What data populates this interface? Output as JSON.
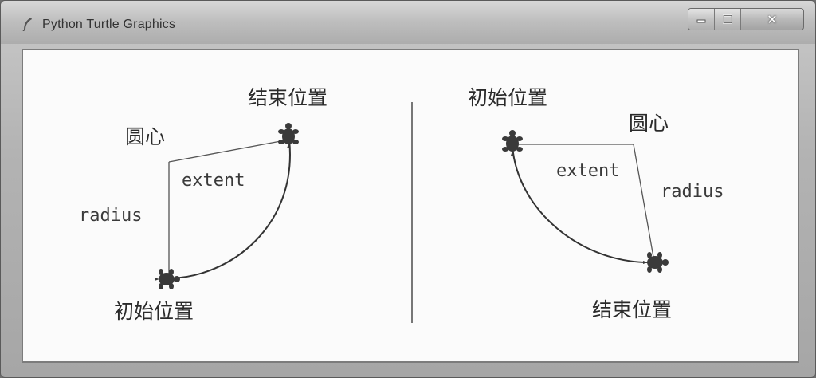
{
  "window": {
    "title": "Python Turtle Graphics",
    "close_glyph": "✕"
  },
  "left_diagram": {
    "end_label": "结束位置",
    "center_label": "圆心",
    "extent_label": "extent",
    "radius_label": "radius",
    "start_label": "初始位置"
  },
  "right_diagram": {
    "start_label": "初始位置",
    "center_label": "圆心",
    "extent_label": "extent",
    "radius_label": "radius",
    "end_label": "结束位置"
  },
  "colors": {
    "ink": "#3a3a3a",
    "canvas": "#fbfbfb"
  }
}
